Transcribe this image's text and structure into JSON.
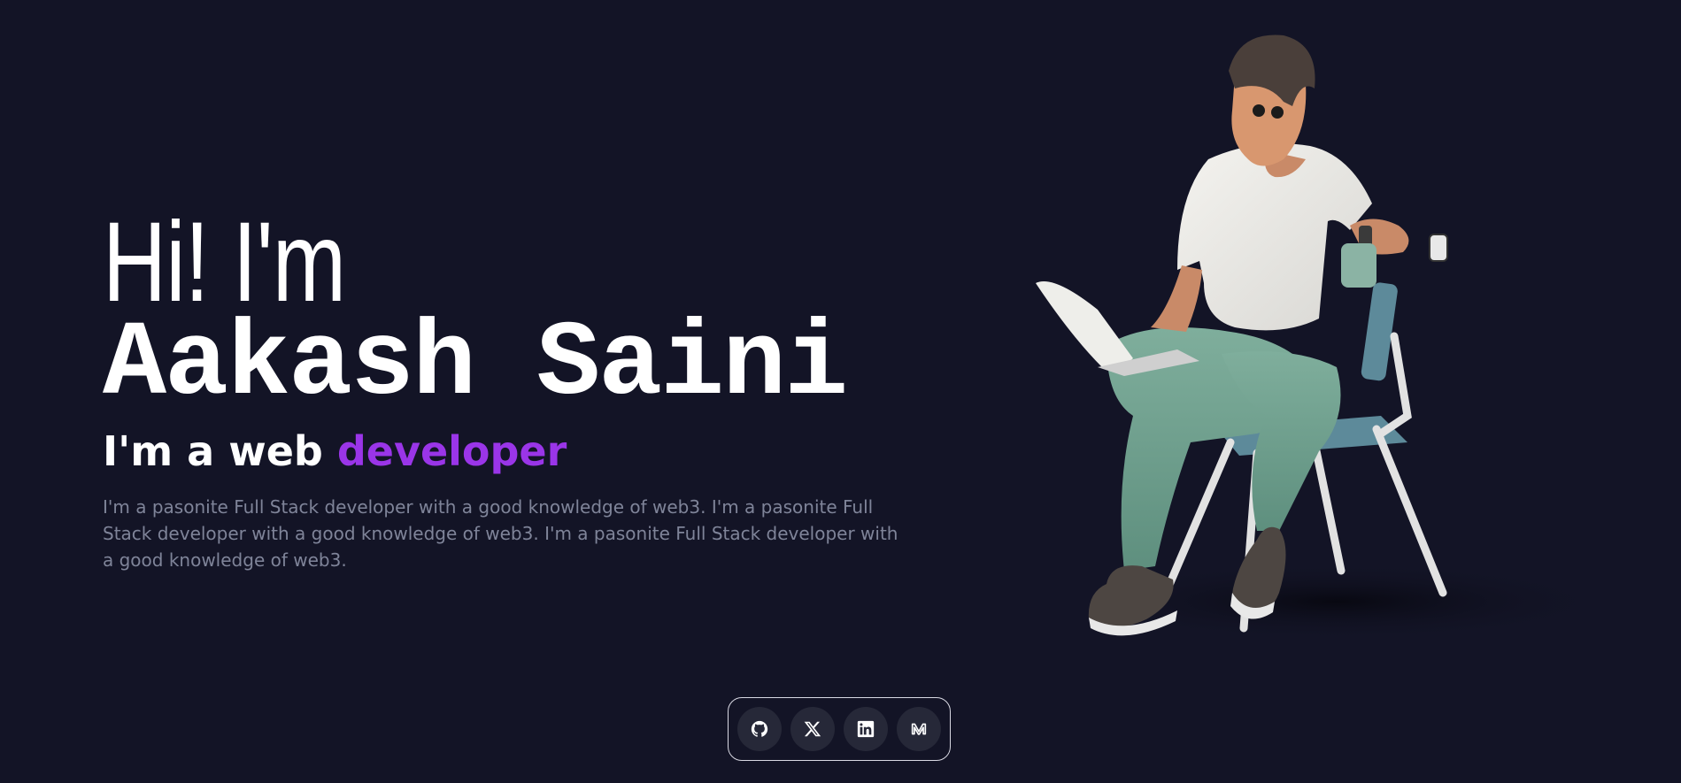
{
  "hero": {
    "greeting": "Hi! I'm",
    "name": "Aakash Saini",
    "role_prefix": "I'm a web",
    "role_highlight": "developer",
    "bio": "I'm a pasonite Full Stack developer with a good knowledge of web3. I'm a pasonite Full Stack developer with a good knowledge of web3. I'm a pasonite Full Stack developer with a good knowledge of web3."
  },
  "colors": {
    "background": "#131426",
    "accent": "#9a35e8",
    "text": "#ffffff",
    "muted_text": "#7f8499"
  },
  "social": [
    {
      "icon": "github-icon"
    },
    {
      "icon": "x-icon"
    },
    {
      "icon": "linkedin-icon"
    },
    {
      "icon": "medium-icon"
    }
  ]
}
